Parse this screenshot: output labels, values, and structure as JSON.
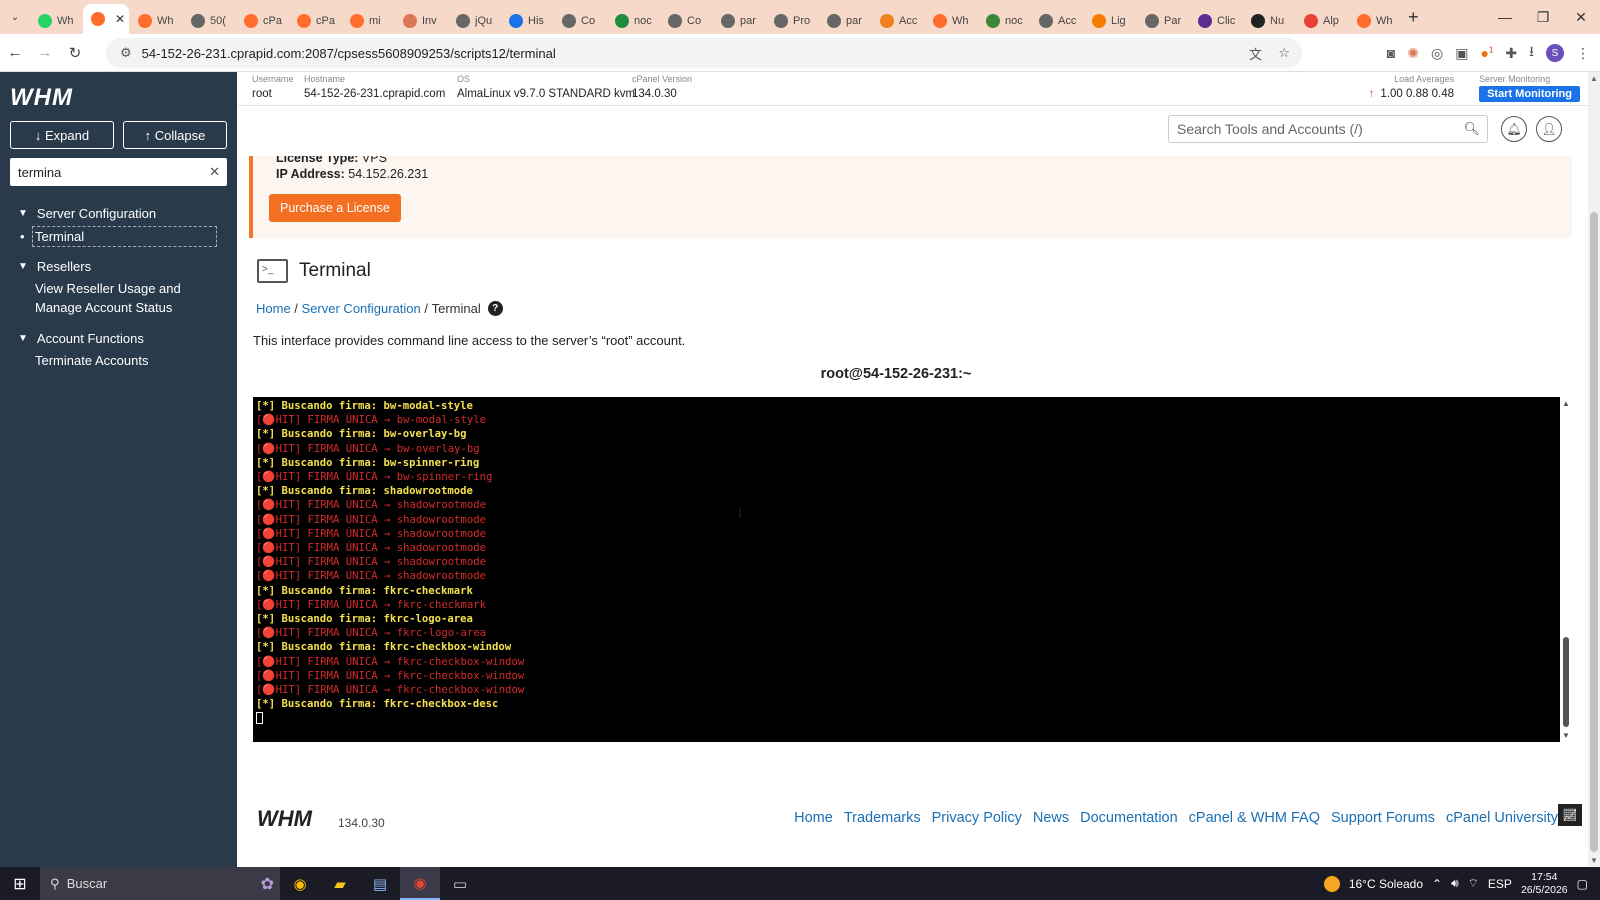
{
  "browser": {
    "tabs": [
      {
        "label": "Wh",
        "icon": "whatsapp-icon",
        "color": "#25d366"
      },
      {
        "label": "",
        "icon": "cpanel-icon",
        "color": "#ff6c2c",
        "active": true
      },
      {
        "label": "Wh",
        "icon": "cpanel-icon",
        "color": "#ff6c2c"
      },
      {
        "label": "50(",
        "icon": "globe-icon",
        "color": "#666666"
      },
      {
        "label": "cPa",
        "icon": "cpanel-icon",
        "color": "#ff6c2c"
      },
      {
        "label": "cPa",
        "icon": "cpanel-icon",
        "color": "#ff6c2c"
      },
      {
        "label": "mi",
        "icon": "cpanel-icon",
        "color": "#ff6c2c"
      },
      {
        "label": "Inv",
        "icon": "claude-icon",
        "color": "#d97757"
      },
      {
        "label": "jQu",
        "icon": "globe-icon",
        "color": "#666666"
      },
      {
        "label": "His",
        "icon": "download-icon",
        "color": "#1a73e8"
      },
      {
        "label": "Co",
        "icon": "globe-icon",
        "color": "#666666"
      },
      {
        "label": "noc",
        "icon": "monitor-icon",
        "color": "#1e8e3e"
      },
      {
        "label": "Co",
        "icon": "globe-icon",
        "color": "#666666"
      },
      {
        "label": "par",
        "icon": "globe-icon",
        "color": "#666666"
      },
      {
        "label": "Pro",
        "icon": "globe-icon",
        "color": "#666666"
      },
      {
        "label": "par",
        "icon": "globe-icon",
        "color": "#666666"
      },
      {
        "label": "Acc",
        "icon": "cloudflare-icon",
        "color": "#f38020"
      },
      {
        "label": "Wh",
        "icon": "cpanel-icon",
        "color": "#ff6c2c"
      },
      {
        "label": "noc",
        "icon": "node-icon",
        "color": "#3c873a"
      },
      {
        "label": "Acc",
        "icon": "globe-icon",
        "color": "#666666"
      },
      {
        "label": "Lig",
        "icon": "lighthouse-icon",
        "color": "#f57c00"
      },
      {
        "label": "Par",
        "icon": "globe-icon",
        "color": "#666666"
      },
      {
        "label": "Clic",
        "icon": "ai-icon",
        "color": "#5c2d91"
      },
      {
        "label": "Nu",
        "icon": "globe-icon",
        "color": "#222222"
      },
      {
        "label": "Alp",
        "icon": "gmail-icon",
        "color": "#ea4335"
      },
      {
        "label": "Wh",
        "icon": "cpanel-icon",
        "color": "#ff6c2c"
      }
    ],
    "url": "54-152-26-231.cprapid.com:2087/cpsess5608909253/scripts12/terminal",
    "profile_initial": "S",
    "ext_badge": "1"
  },
  "whm": {
    "logo": "WHM",
    "expand_label": "↓ Expand",
    "collapse_label": "↑ Collapse",
    "filter_value": "termina",
    "sidebar": [
      {
        "type": "group",
        "label": "Server Configuration"
      },
      {
        "type": "item",
        "label": "Terminal",
        "selected": true
      },
      {
        "type": "group",
        "label": "Resellers"
      },
      {
        "type": "item",
        "label": "View Reseller Usage and Manage Account Status"
      },
      {
        "type": "group",
        "label": "Account Functions"
      },
      {
        "type": "item",
        "label": "Terminate Accounts"
      }
    ],
    "server": {
      "username_label": "Username",
      "username": "root",
      "hostname_label": "Hostname",
      "hostname": "54-152-26-231.cprapid.com",
      "os_label": "OS",
      "os": "AlmaLinux v9.7.0 STANDARD kvm",
      "cpanel_label": "cPanel Version",
      "cpanel": "134.0.30",
      "load_label": "Load Averages",
      "load": [
        "1.00",
        "0.88",
        "0.48"
      ],
      "monitor_label": "Server Monitoring",
      "monitor_button": "Start Monitoring"
    },
    "search_placeholder": "Search Tools and Accounts (/)",
    "license": {
      "type_label": "License Type:",
      "type": "VPS",
      "ip_label": "IP Address:",
      "ip": "54.152.26.231",
      "purchase": "Purchase a License"
    },
    "page_title": "Terminal",
    "breadcrumb": {
      "home": "Home",
      "section": "Server Configuration",
      "current": "Terminal"
    },
    "description": "This interface provides command line access to the server’s “root” account.",
    "terminal_title": "root@54-152-26-231:~",
    "terminal_lines": [
      {
        "kind": "y",
        "text": "[*] Buscando firma: bw-modal-style"
      },
      {
        "kind": "r",
        "text": "[🔴HIT] FIRMA ÚNICA → bw-modal-style"
      },
      {
        "kind": "y",
        "text": "[*] Buscando firma: bw-overlay-bg"
      },
      {
        "kind": "r",
        "text": "[🔴HIT] FIRMA ÚNICA → bw-overlay-bg"
      },
      {
        "kind": "y",
        "text": "[*] Buscando firma: bw-spinner-ring"
      },
      {
        "kind": "r",
        "text": "[🔴HIT] FIRMA ÚNICA → bw-spinner-ring"
      },
      {
        "kind": "y",
        "text": "[*] Buscando firma: shadowrootmode"
      },
      {
        "kind": "r",
        "text": "[🔴HIT] FIRMA ÚNICA → shadowrootmode"
      },
      {
        "kind": "r",
        "text": "[🔴HIT] FIRMA ÚNICA → shadowrootmode"
      },
      {
        "kind": "r",
        "text": "[🔴HIT] FIRMA ÚNICA → shadowrootmode"
      },
      {
        "kind": "r",
        "text": "[🔴HIT] FIRMA ÚNICA → shadowrootmode"
      },
      {
        "kind": "r",
        "text": "[🔴HIT] FIRMA ÚNICA → shadowrootmode"
      },
      {
        "kind": "r",
        "text": "[🔴HIT] FIRMA ÚNICA → shadowrootmode"
      },
      {
        "kind": "y",
        "text": "[*] Buscando firma: fkrc-checkmark"
      },
      {
        "kind": "r",
        "text": "[🔴HIT] FIRMA ÚNICA → fkrc-checkmark"
      },
      {
        "kind": "y",
        "text": "[*] Buscando firma: fkrc-logo-area"
      },
      {
        "kind": "r",
        "text": "[🔴HIT] FIRMA ÚNICA → fkrc-logo-area"
      },
      {
        "kind": "y",
        "text": "[*] Buscando firma: fkrc-checkbox-window"
      },
      {
        "kind": "r",
        "text": "[🔴HIT] FIRMA ÚNICA → fkrc-checkbox-window"
      },
      {
        "kind": "r",
        "text": "[🔴HIT] FIRMA ÚNICA → fkrc-checkbox-window"
      },
      {
        "kind": "r",
        "text": "[🔴HIT] FIRMA ÚNICA → fkrc-checkbox-window"
      },
      {
        "kind": "y",
        "text": "[*] Buscando firma: fkrc-checkbox-desc"
      }
    ],
    "footer": {
      "logo": "WHM",
      "version": "134.0.30",
      "links": [
        "Home",
        "Trademarks",
        "Privacy Policy",
        "News",
        "Documentation",
        "cPanel & WHM FAQ",
        "Support Forums",
        "cPanel University"
      ]
    }
  },
  "taskbar": {
    "search_placeholder": "Buscar",
    "weather": "16°C Soleado",
    "lang": "ESP",
    "time": "17:54",
    "date": "26/5/2026"
  },
  "colors": {
    "sidebar_bg": "#293a4a",
    "accent_orange": "#f36f21",
    "link": "#1a6fb5",
    "terminal_yellow": "#f4e04d",
    "terminal_red": "#d42a2a",
    "tabbar_bg": "#f7d9c9"
  }
}
